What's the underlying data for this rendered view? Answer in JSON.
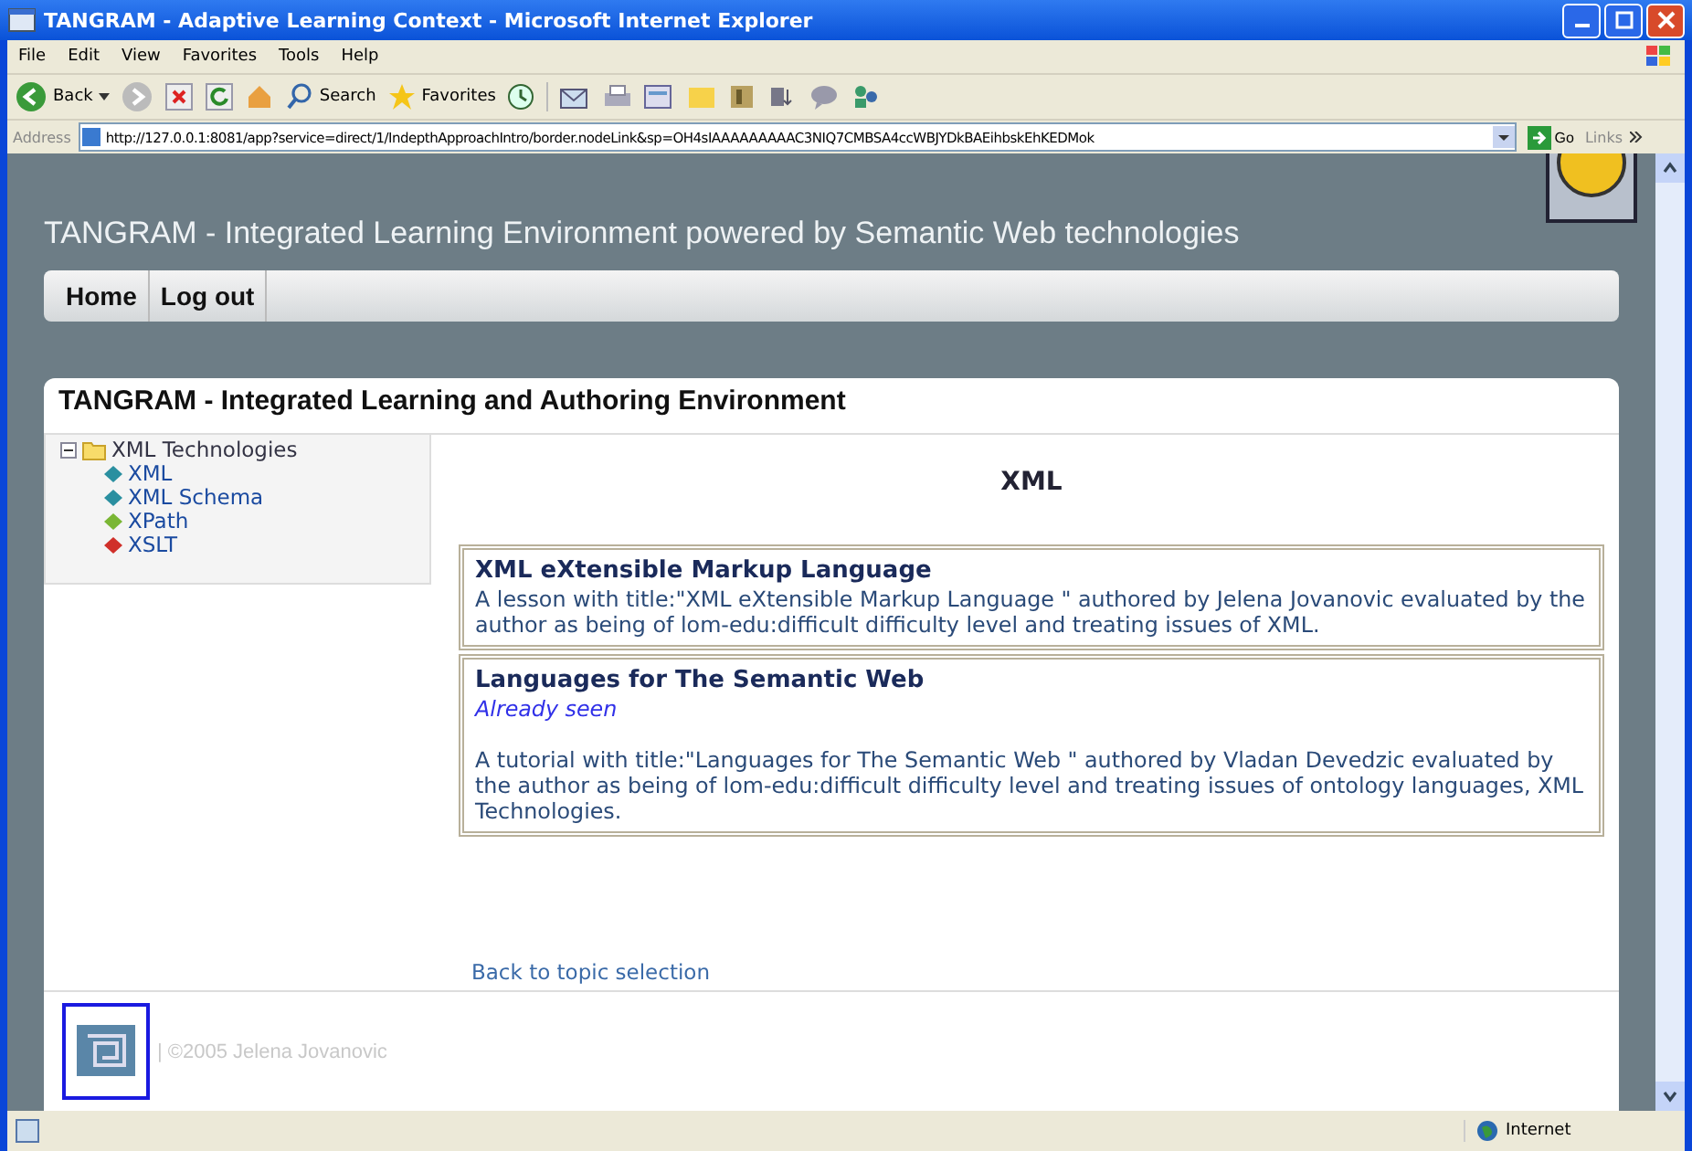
{
  "window": {
    "title": "TANGRAM - Adaptive Learning Context - Microsoft Internet Explorer"
  },
  "menu": [
    "File",
    "Edit",
    "View",
    "Favorites",
    "Tools",
    "Help"
  ],
  "toolbar": {
    "back": "Back",
    "search": "Search",
    "favorites": "Favorites"
  },
  "address": {
    "label": "Address",
    "url": "http://127.0.0.1:8081/app?service=direct/1/IndepthApproachIntro/border.nodeLink&sp=OH4sIAAAAAAAAAC3NIQ7CMBSA4ccWBJYDkBAEihbskEhKEDMok",
    "go": "Go",
    "links": "Links"
  },
  "page": {
    "header": "TANGRAM - Integrated Learning Environment powered by Semantic Web technologies",
    "nav": [
      {
        "label": "Home"
      },
      {
        "label": "Log out"
      }
    ],
    "panel_title": "TANGRAM - Integrated Learning and Authoring Environment",
    "tree": [
      {
        "label": "XML Technologies",
        "expanded": true,
        "children": [
          {
            "label": "XML",
            "color": "#2a8fa0"
          },
          {
            "label": "XML Schema",
            "color": "#2a8fa0"
          },
          {
            "label": "XPath",
            "color": "#7ab634"
          },
          {
            "label": "XSLT",
            "color": "#d0302a"
          }
        ]
      }
    ],
    "topic": "XML",
    "resources": [
      {
        "title": "XML eXtensible Markup Language",
        "seen": false,
        "description": "A lesson with title:\"XML eXtensible Markup Language \" authored by Jelena Jovanovic evaluated by the author as being of lom-edu:difficult difficulty level and treating issues of XML."
      },
      {
        "title": "Languages for The Semantic Web",
        "seen": true,
        "seen_label": "Already seen",
        "description": "A tutorial with title:\"Languages for The Semantic Web \" authored by Vladan Devedzic evaluated by the author as being of lom-edu:difficult difficulty level and treating issues of ontology languages, XML Technologies."
      }
    ],
    "back_link": "Back to topic selection",
    "copyright": "| ©2005 Jelena Jovanovic"
  },
  "status_bar": {
    "zone": "Internet"
  }
}
